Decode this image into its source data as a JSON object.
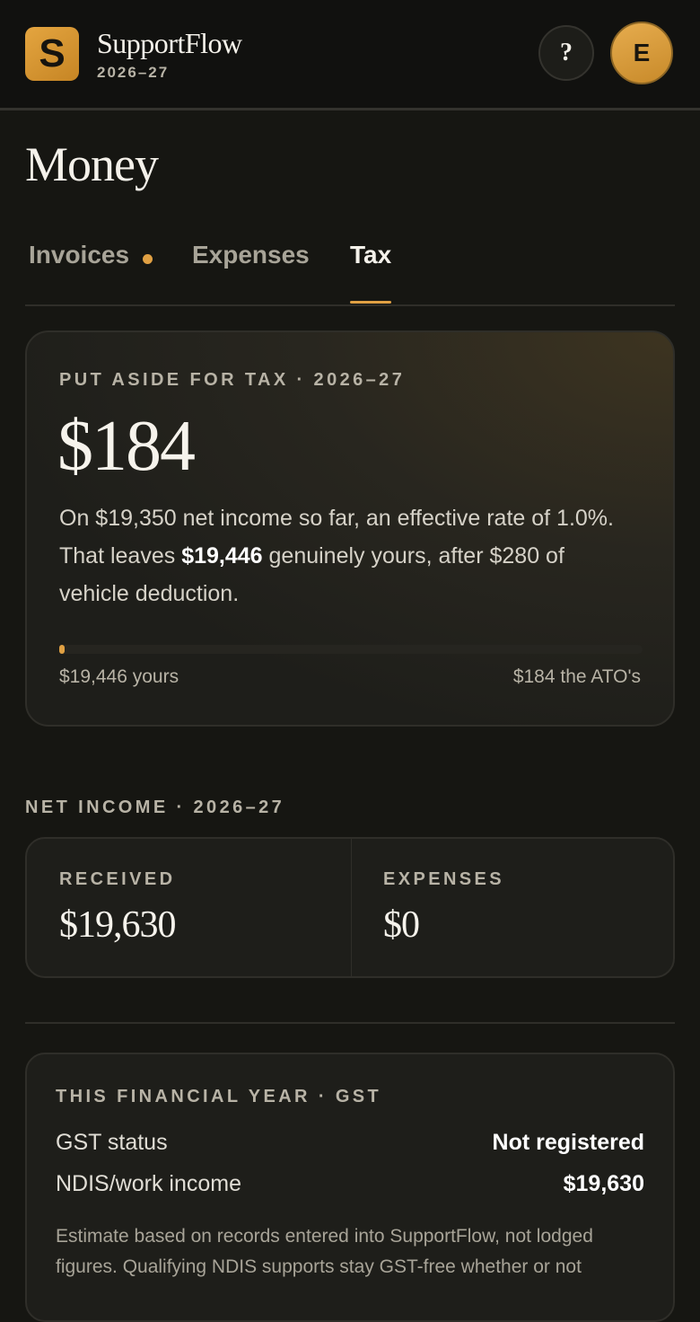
{
  "app": {
    "logo_letter": "S",
    "name": "SupportFlow",
    "year": "2026–27"
  },
  "header": {
    "help_label": "?",
    "avatar_initial": "E"
  },
  "page": {
    "title": "Money"
  },
  "tabs": [
    {
      "label": "Invoices",
      "has_badge": true
    },
    {
      "label": "Expenses"
    },
    {
      "label": "Tax",
      "active": true
    }
  ],
  "tax_card": {
    "eyebrow": "PUT ASIDE FOR TAX · 2026–27",
    "amount": "$184",
    "desc_part1": "On $19,350 net income so far, an effective rate of 1.0%. That leaves ",
    "desc_bold": "$19,446",
    "desc_part2": " genuinely yours, after $280 of vehicle deduction.",
    "bar_fraction": 0.0094,
    "left_label": "$19,446 yours",
    "right_label": "$184 the ATO's"
  },
  "net_income": {
    "title": "NET INCOME · 2026–27",
    "received_label": "RECEIVED",
    "received_value": "$19,630",
    "expenses_label": "EXPENSES",
    "expenses_value": "$0"
  },
  "gst": {
    "eyebrow": "THIS FINANCIAL YEAR · GST",
    "rows": [
      {
        "label": "GST status",
        "value": "Not registered"
      },
      {
        "label": "NDIS/work income",
        "value": "$19,630"
      }
    ],
    "note": "Estimate based on records entered into SupportFlow, not lodged figures. Qualifying NDIS supports stay GST-free whether or not"
  },
  "colors": {
    "accent": "#e0a043",
    "background": "#161612",
    "card": "#1e1e1a"
  }
}
